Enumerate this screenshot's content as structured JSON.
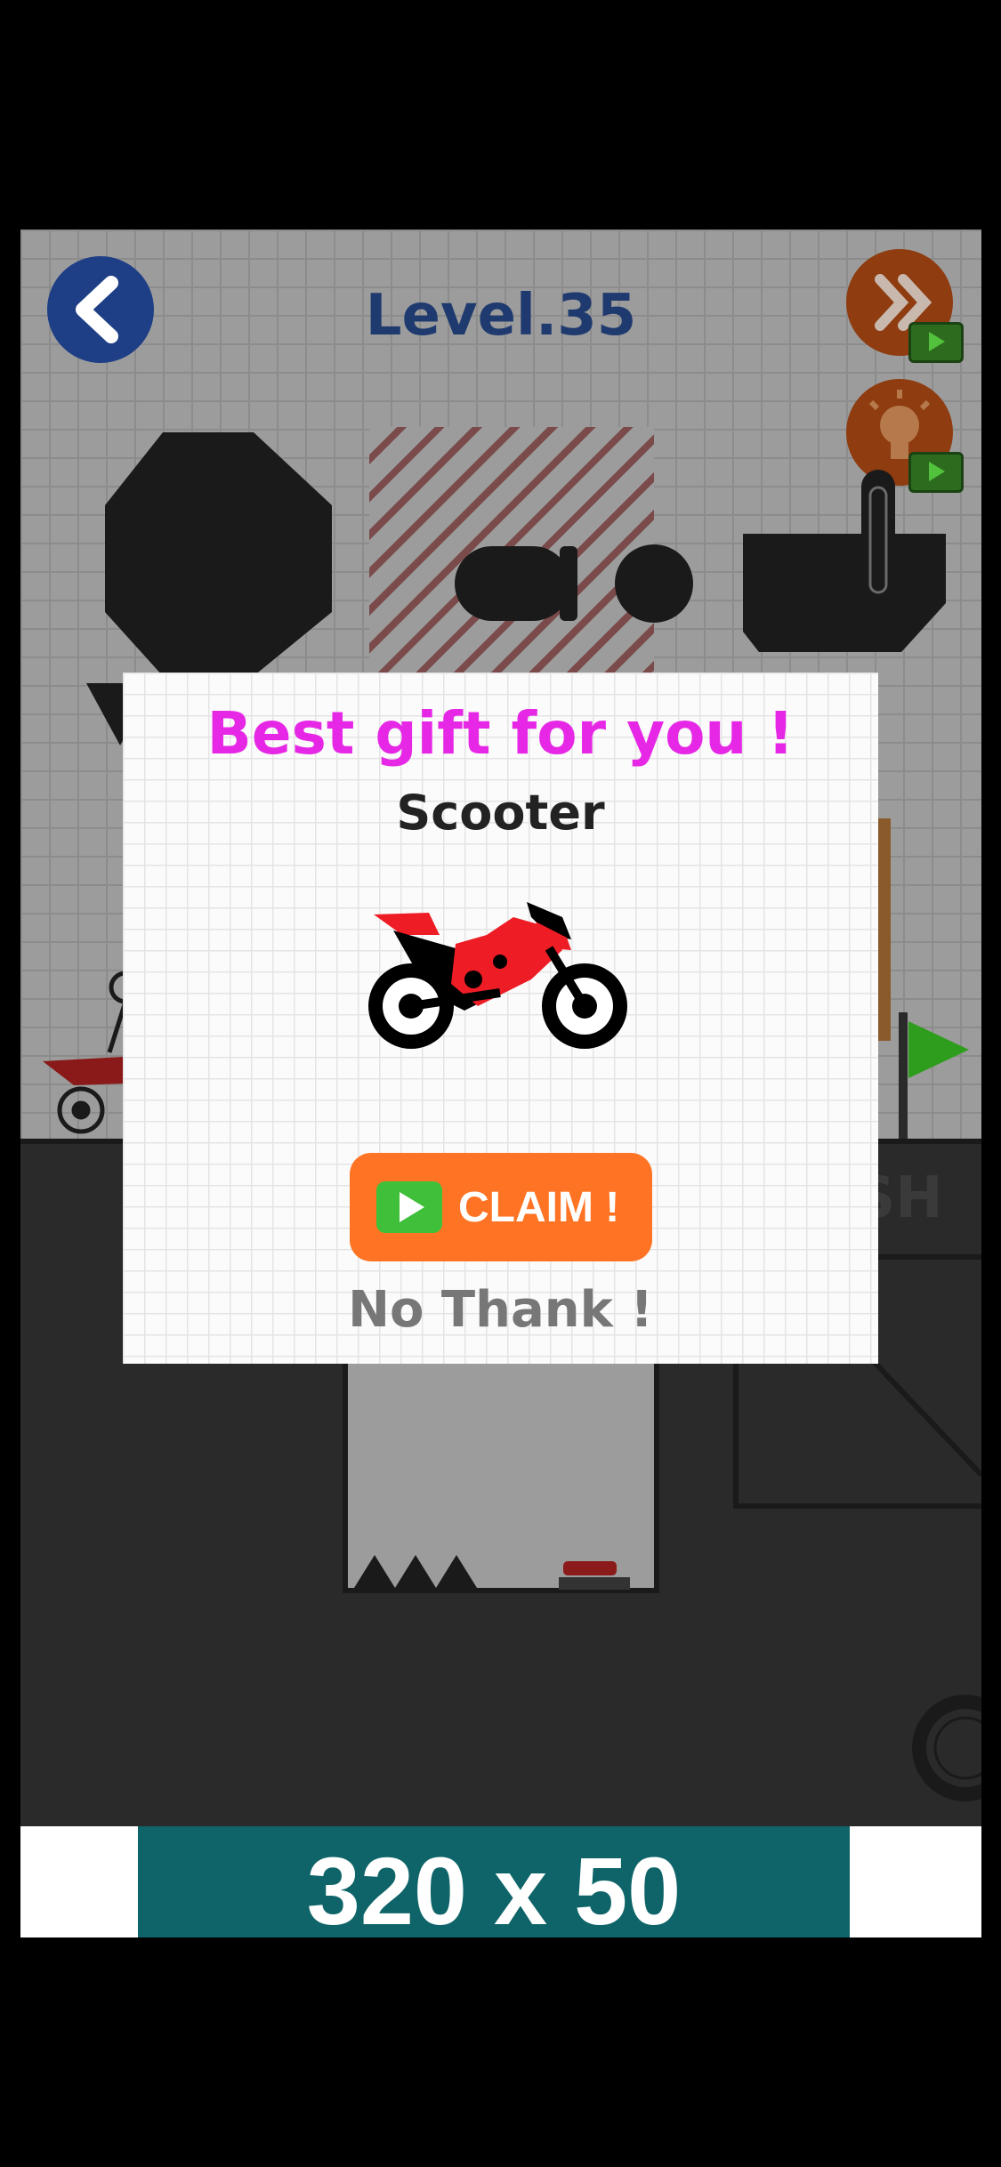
{
  "header": {
    "level_title": "Level.35"
  },
  "popup": {
    "title": "Best gift for you !",
    "item_name": "Scooter",
    "claim_label": "CLAIM !",
    "decline_label": "No Thank !"
  },
  "scene": {
    "finish_partial_text": "ISH"
  },
  "ad_banner": {
    "text": "320 x 50"
  },
  "colors": {
    "popup_title": "#e628e6",
    "claim_button": "#ff7424",
    "back_button": "#1e3f86",
    "level_title": "#1f3a6e",
    "flag": "#2e9c1c",
    "ad_banner": "#0e6468"
  }
}
